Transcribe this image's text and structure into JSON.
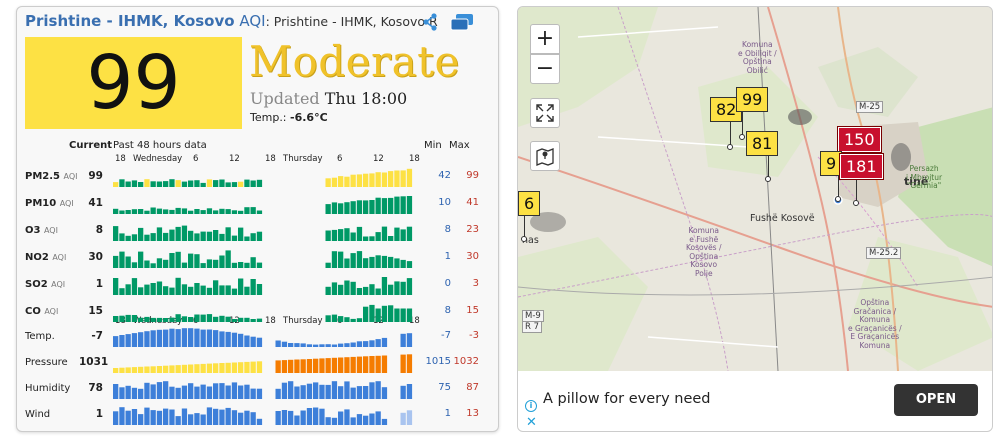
{
  "station": {
    "title": "Prishtine - IHMK, Kosovo",
    "aqi_word": "AQI",
    "subtitle": ": Prishtine - IHMK, Kosovo R",
    "aqi": "99",
    "status": "Moderate",
    "updated_label": "Updated",
    "updated_value": "Thu 18:00",
    "temp_label": "Temp.:",
    "temp_value": "-6.6°C",
    "colors": {
      "moderate": "#fde144",
      "good": "#009966",
      "unhealthy": "#cc0033",
      "weather_blue": "#3d7fd9",
      "pressure_orange": "#f57c00"
    }
  },
  "table": {
    "hdr_current": "Current",
    "hdr_past": "Past 48 hours data",
    "hdr_min": "Min",
    "hdr_max": "Max",
    "ticks": [
      "18",
      "Wednesday",
      "6",
      "12",
      "18",
      "Thursday",
      "6",
      "12",
      "18"
    ],
    "pollutants": [
      {
        "name": "PM2.5",
        "unit": "AQI",
        "current": "99",
        "min": "42",
        "max": "99"
      },
      {
        "name": "PM10",
        "unit": "AQI",
        "current": "41",
        "min": "10",
        "max": "41"
      },
      {
        "name": "O3",
        "unit": "AQI",
        "current": "8",
        "min": "8",
        "max": "23"
      },
      {
        "name": "NO2",
        "unit": "AQI",
        "current": "30",
        "min": "1",
        "max": "30"
      },
      {
        "name": "SO2",
        "unit": "AQI",
        "current": "1",
        "min": "0",
        "max": "3"
      },
      {
        "name": "CO",
        "unit": "AQI",
        "current": "15",
        "min": "8",
        "max": "15"
      }
    ],
    "weather": [
      {
        "name": "Temp.",
        "current": "-7",
        "min": "-7",
        "max": "-3"
      },
      {
        "name": "Pressure",
        "current": "1031",
        "min": "1015",
        "max": "1032"
      },
      {
        "name": "Humidity",
        "current": "78",
        "min": "75",
        "max": "87"
      },
      {
        "name": "Wind",
        "current": "1",
        "min": "1",
        "max": "13"
      }
    ]
  },
  "map": {
    "zoom_in": "+",
    "zoom_out": "−",
    "markers": [
      {
        "label": "82",
        "level": "moderate"
      },
      {
        "label": "99",
        "level": "moderate"
      },
      {
        "label": "81",
        "level": "moderate"
      },
      {
        "label": "150",
        "level": "unhealthy"
      },
      {
        "label": "9",
        "level": "moderate"
      },
      {
        "label": "181",
        "level": "unhealthy"
      },
      {
        "label": "6",
        "level": "moderate"
      }
    ],
    "places": {
      "fushe": "Fushë Kosovë",
      "nas": "nas",
      "komuna_obiliq": "Komuna\ne Obiliqit /\nOpština\nObilić",
      "komuna_fushe": "Komuna\ne Fushë\nKosovës /\nOpština\nKosovo\nPolje",
      "komuna_gracanica": "Opština\nGračanica /\nKomuna\ne Graçanicës /\nE Graçanicës\nKomuna",
      "germia": "Persazh\ni Mbrojtur\n\"Gërmia\"",
      "tine": "tinë",
      "m25": "M-25",
      "m252": "M-25.2",
      "m9": "M-9",
      "r7": "R 7"
    }
  },
  "ad": {
    "text": "A pillow for every need",
    "button": "OPEN",
    "info": "i",
    "close": "✕"
  }
}
